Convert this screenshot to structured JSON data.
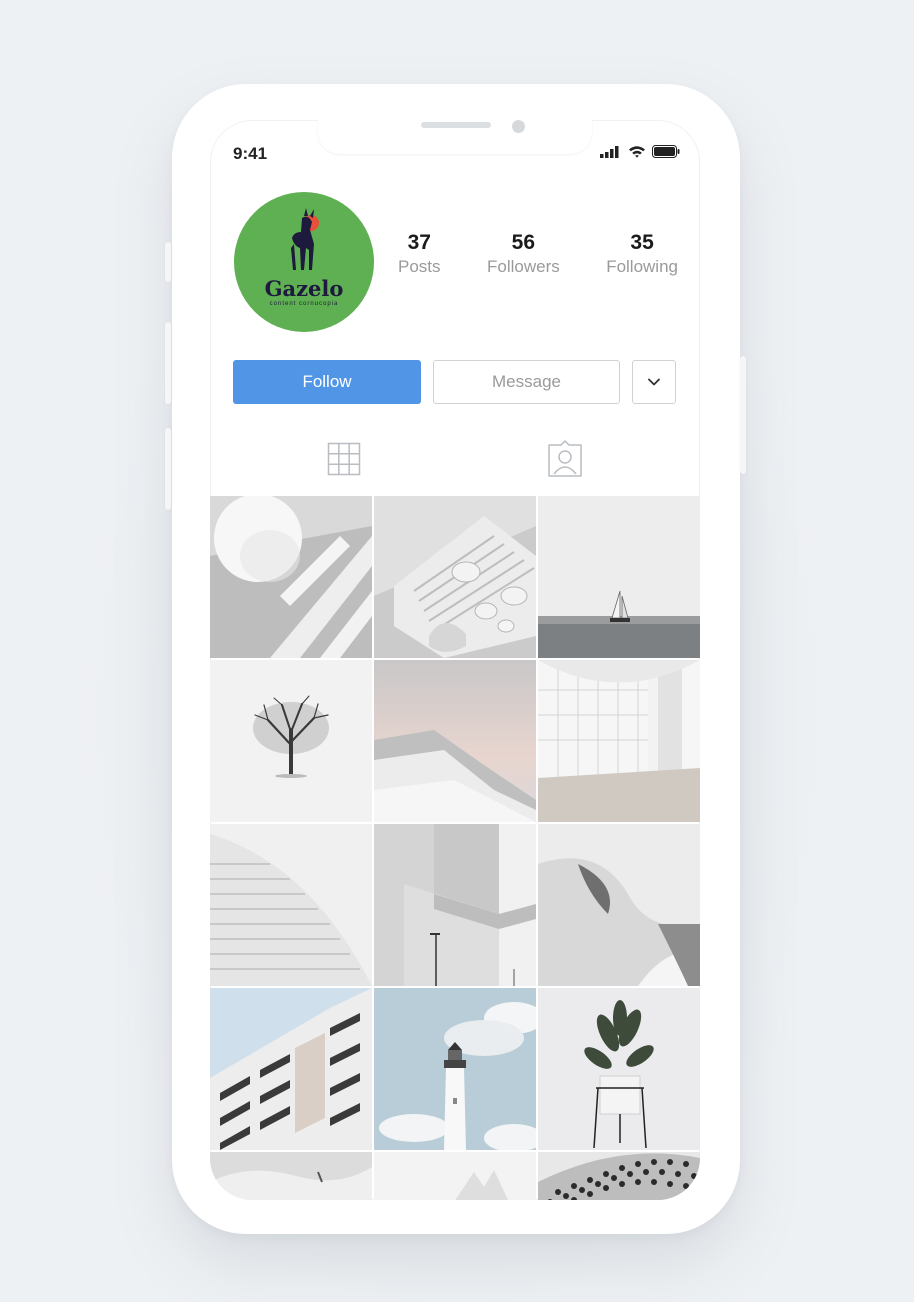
{
  "status_bar": {
    "time": "9:41",
    "icons": [
      "signal-icon",
      "wifi-icon",
      "battery-icon"
    ]
  },
  "profile": {
    "avatar_logo": {
      "name": "Gazelo",
      "tagline": "content cornucopia",
      "background_color": "#5fb052"
    },
    "stats": [
      {
        "value": "37",
        "label": "Posts"
      },
      {
        "value": "56",
        "label": "Followers"
      },
      {
        "value": "35",
        "label": "Following"
      }
    ]
  },
  "actions": {
    "follow_label": "Follow",
    "message_label": "Message",
    "more_icon": "chevron-down-icon"
  },
  "tabs": [
    {
      "icon": "grid-icon"
    },
    {
      "icon": "tagged-person-icon"
    }
  ],
  "posts": [
    {
      "subject": "sphere-and-stripes"
    },
    {
      "subject": "zen-stones"
    },
    {
      "subject": "sailboat-at-sea"
    },
    {
      "subject": "lone-tree-in-snow"
    },
    {
      "subject": "snowy-hillside-sunset"
    },
    {
      "subject": "white-tiled-interior"
    },
    {
      "subject": "curved-staircase"
    },
    {
      "subject": "concrete-building"
    },
    {
      "subject": "abstract-curve"
    },
    {
      "subject": "apartment-facade"
    },
    {
      "subject": "lighthouse"
    },
    {
      "subject": "potted-plant"
    },
    {
      "subject": "snow-texture"
    },
    {
      "subject": "snowy-peaks"
    },
    {
      "subject": "geometric-facade"
    }
  ],
  "colors": {
    "accent": "#5196e6",
    "background": "#eef1f4"
  }
}
